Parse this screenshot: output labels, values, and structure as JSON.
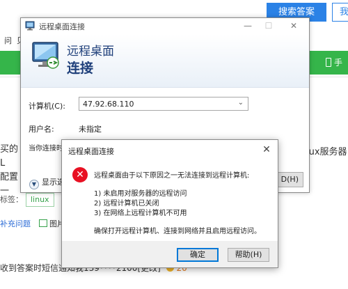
{
  "background": {
    "search_button": "搜索答案",
    "search_button2": "我",
    "nav_items": [
      "问",
      "贝"
    ],
    "green_bar_right": "手",
    "left_text_line1": "买的L",
    "left_text_line2": "配置一",
    "right_text": "lux服务器",
    "tag_label": "标签：",
    "tags": [
      "linux"
    ],
    "action_links": [
      "补充问题",
      "图片"
    ],
    "notice_text": "收到答案时短信通知我139****2100[更改]",
    "notice_coins": "20",
    "colors": {
      "green_bar": "#35b54a",
      "search_blue": "#2b82e6"
    }
  },
  "rdc_window": {
    "title": "远程桌面连接",
    "icon": "remote-desktop-icon",
    "banner_line1": "远程桌面",
    "banner_line2": "连接",
    "computer_label": "计算机(C):",
    "computer_value": "47.92.68.110",
    "username_label": "用户名:",
    "username_value": "未指定",
    "connecting_label": "当你连接时",
    "options_label": "显示选",
    "connect_label": "D(H)",
    "controls": {
      "minimize": "—",
      "maximize": "☐",
      "close": "✕"
    }
  },
  "error_dialog": {
    "title": "远程桌面连接",
    "icon": "error-icon",
    "message_intro": "远程桌面由于以下原因之一无法连接到远程计算机:",
    "reasons": [
      "1) 未启用对服务器的远程访问",
      "2) 远程计算机已关闭",
      "3) 在网络上远程计算机不可用"
    ],
    "advice": "确保打开远程计算机、连接到网络并且启用远程访问。",
    "ok_label": "确定",
    "help_label": "帮助(H)",
    "close_glyph": "✕"
  }
}
